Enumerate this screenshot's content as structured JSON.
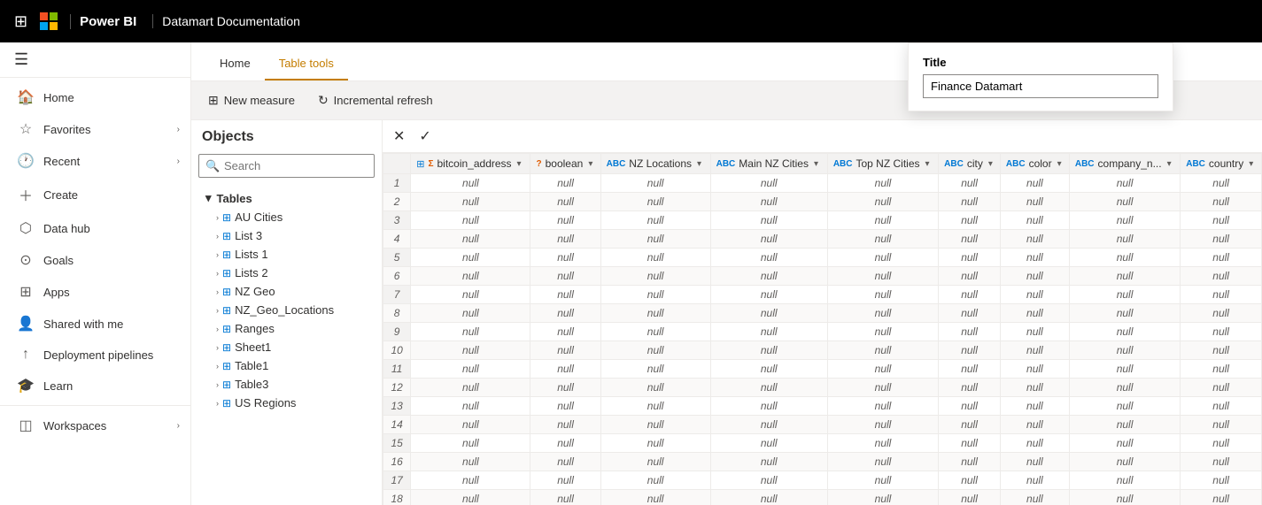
{
  "topbar": {
    "waffle_icon": "⊞",
    "brand": "Power BI",
    "separator": "|",
    "breadcrumb": "Datamart Documentation",
    "finance_title": "Finance Datamart"
  },
  "title_popup": {
    "label": "Title",
    "value": "Finance Datamart"
  },
  "sidebar": {
    "hamburger_icon": "☰",
    "items": [
      {
        "id": "home",
        "label": "Home",
        "icon": "🏠",
        "has_chevron": false
      },
      {
        "id": "favorites",
        "label": "Favorites",
        "icon": "☆",
        "has_chevron": true
      },
      {
        "id": "recent",
        "label": "Recent",
        "icon": "🕐",
        "has_chevron": true
      },
      {
        "id": "create",
        "label": "Create",
        "icon": "+",
        "has_chevron": false
      },
      {
        "id": "datahub",
        "label": "Data hub",
        "icon": "⬡",
        "has_chevron": false
      },
      {
        "id": "goals",
        "label": "Goals",
        "icon": "⊙",
        "has_chevron": false
      },
      {
        "id": "apps",
        "label": "Apps",
        "icon": "⊞",
        "has_chevron": false
      },
      {
        "id": "sharedwithme",
        "label": "Shared with me",
        "icon": "👤",
        "has_chevron": false
      },
      {
        "id": "deployment",
        "label": "Deployment pipelines",
        "icon": "↑",
        "has_chevron": false
      },
      {
        "id": "learn",
        "label": "Learn",
        "icon": "🎓",
        "has_chevron": false
      },
      {
        "id": "workspaces",
        "label": "Workspaces",
        "icon": "◫",
        "has_chevron": true
      }
    ]
  },
  "tabs": [
    {
      "id": "home",
      "label": "Home",
      "active": false
    },
    {
      "id": "tabletools",
      "label": "Table tools",
      "active": true
    }
  ],
  "toolbar": {
    "new_measure_label": "New measure",
    "incremental_refresh_label": "Incremental refresh"
  },
  "objects_panel": {
    "title": "Objects",
    "search_placeholder": "Search",
    "sections": [
      {
        "title": "Tables",
        "items": [
          "AU Cities",
          "List 3",
          "Lists 1",
          "Lists 2",
          "NZ Geo",
          "NZ_Geo_Locations",
          "Ranges",
          "Sheet1",
          "Table1",
          "Table3",
          "US Regions"
        ]
      }
    ]
  },
  "grid": {
    "columns": [
      {
        "type": "table",
        "name": "bitcoin_address"
      },
      {
        "type": "bool",
        "name": "boolean"
      },
      {
        "type": "abc",
        "name": "NZ Locations"
      },
      {
        "type": "abc",
        "name": "Main NZ Cities"
      },
      {
        "type": "abc",
        "name": "Top NZ Cities"
      },
      {
        "type": "abc",
        "name": "city"
      },
      {
        "type": "abc",
        "name": "color"
      },
      {
        "type": "abc",
        "name": "company_n..."
      },
      {
        "type": "abc",
        "name": "country"
      }
    ],
    "row_count": 18,
    "null_value": "null"
  }
}
